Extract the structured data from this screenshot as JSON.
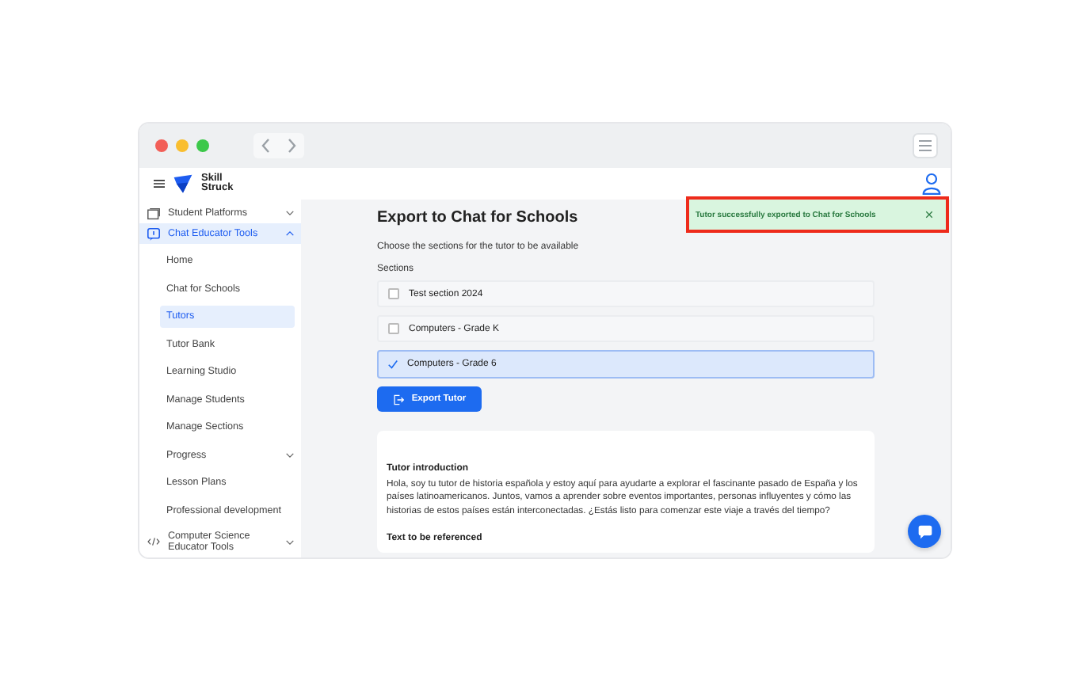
{
  "header": {
    "brand": [
      "Skill",
      "Struck"
    ]
  },
  "sidebar": {
    "items": [
      {
        "label": "Student Platforms",
        "expanded": false,
        "selected": false
      },
      {
        "label": "Chat Educator Tools",
        "expanded": true,
        "selected": true,
        "children": [
          {
            "label": "Home",
            "selected": false
          },
          {
            "label": "Chat for Schools",
            "selected": false
          },
          {
            "label": "Tutors",
            "selected": true
          },
          {
            "label": "Tutor Bank",
            "selected": false
          },
          {
            "label": "Learning Studio",
            "selected": false
          },
          {
            "label": "Manage Students",
            "selected": false
          },
          {
            "label": "Manage Sections",
            "selected": false
          },
          {
            "label": "Progress",
            "selected": false,
            "expandable": true
          },
          {
            "label": "Lesson Plans",
            "selected": false
          },
          {
            "label": "Professional development",
            "selected": false
          }
        ]
      },
      {
        "label": "Computer Science Educator Tools",
        "expanded": false,
        "selected": false
      }
    ]
  },
  "main": {
    "title": "Export to Chat for Schools",
    "subtitle": "Choose the sections for the tutor to be available",
    "sections_label": "Sections",
    "sections": [
      {
        "label": "Test section 2024",
        "checked": false
      },
      {
        "label": "Computers - Grade K",
        "checked": false
      },
      {
        "label": "Computers - Grade 6",
        "checked": true
      }
    ],
    "export_button": "Export Tutor",
    "card": {
      "heading": "Tutor introduction",
      "text": "Hola, soy tu tutor de historia española y estoy aquí para ayudarte a explorar el fascinante pasado de España y los países latinoamericanos. Juntos, vamos a aprender sobre eventos importantes, personas influyentes y cómo las historias de estos países están interconectadas. ¿Estás listo para comenzar este viaje a través del tiempo?",
      "heading_2": "Text to be referenced"
    }
  },
  "toast": {
    "message": "Tutor successfully exported to Chat for Schools",
    "highlighted": true
  }
}
